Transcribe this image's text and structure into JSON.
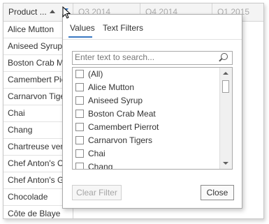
{
  "grid": {
    "columns": [
      "Product ...",
      "Q3 2014",
      "Q4 2014",
      "Q1 2015"
    ],
    "rows": [
      "Alice Mutton",
      "Aniseed Syrup",
      "Boston Crab Meat",
      "Camembert Pierrot",
      "Carnarvon Tigers",
      "Chai",
      "Chang",
      "Chartreuse verte",
      "Chef Anton's Cajun Seasoning",
      "Chef Anton's Gumbo Mix",
      "Chocolade",
      "Côte de Blaye"
    ]
  },
  "filter_popup": {
    "tabs": [
      "Values",
      "Text Filters"
    ],
    "active_tab": "Values",
    "search": {
      "value": "",
      "placeholder": "Enter text to search..."
    },
    "items": [
      {
        "label": "(All)",
        "checked": false
      },
      {
        "label": "Alice Mutton",
        "checked": false
      },
      {
        "label": "Aniseed Syrup",
        "checked": false
      },
      {
        "label": "Boston Crab Meat",
        "checked": false
      },
      {
        "label": "Camembert Pierrot",
        "checked": false
      },
      {
        "label": "Carnarvon Tigers",
        "checked": false
      },
      {
        "label": "Chai",
        "checked": false
      },
      {
        "label": "Chang",
        "checked": false
      }
    ],
    "clear_label": "Clear Filter",
    "close_label": "Close"
  },
  "colors": {
    "accent": "#3a78c2",
    "border": "#a9a9a9"
  },
  "icons": [
    "sort-ascending-icon",
    "filter-icon",
    "search-icon",
    "checkbox-icon",
    "arrow-up-icon",
    "arrow-down-icon",
    "mouse-cursor-icon"
  ]
}
